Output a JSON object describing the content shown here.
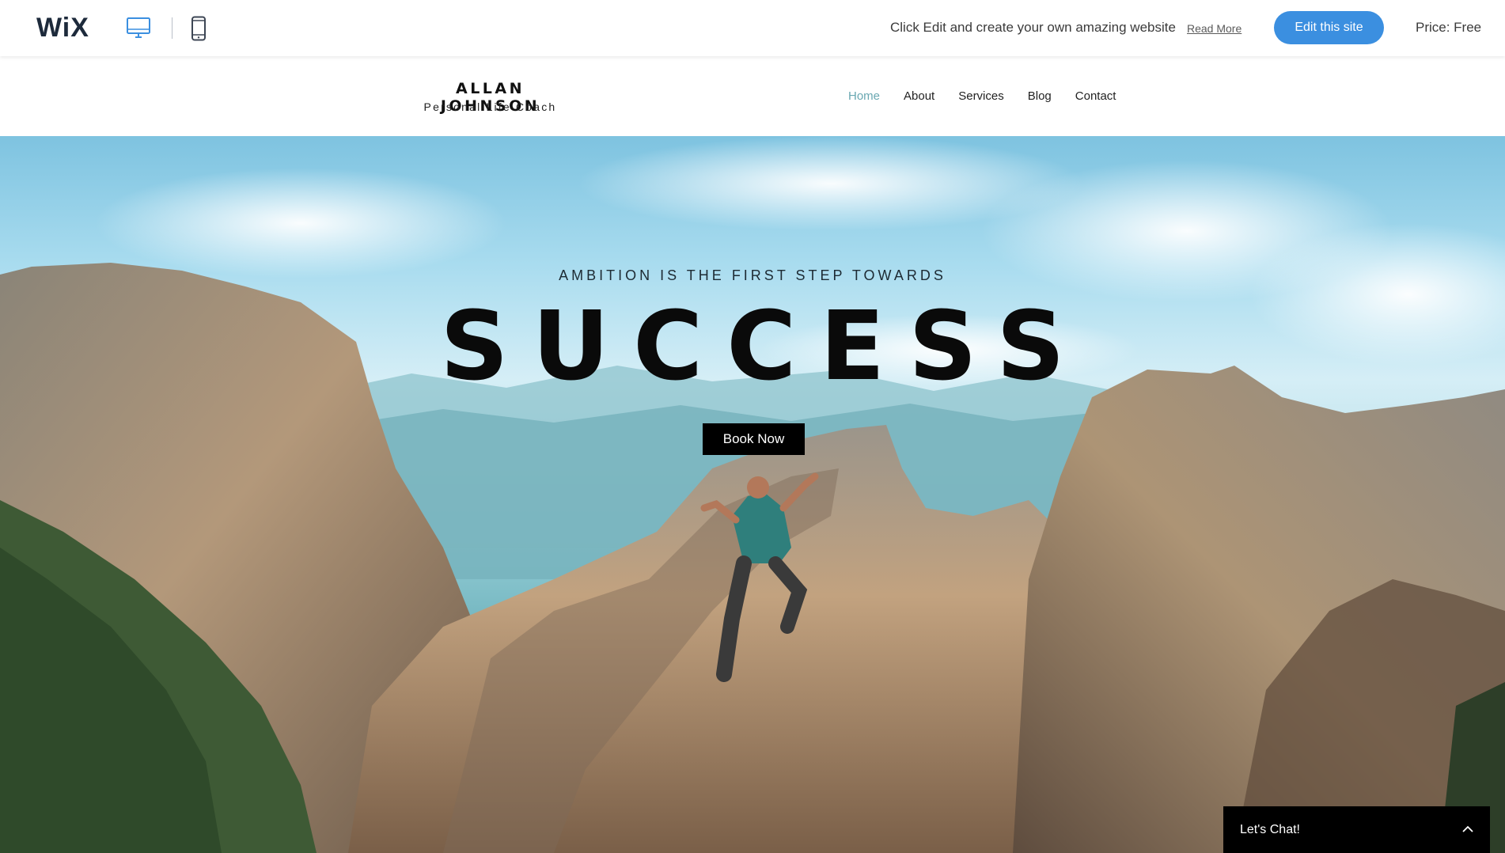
{
  "wix_bar": {
    "logo": "WiX",
    "desktop_icon": "desktop-monitor-icon",
    "mobile_icon": "mobile-phone-icon",
    "promo_text": "Click Edit and create your own amazing website",
    "read_more": "Read More",
    "edit_button": "Edit this site",
    "price": "Price: Free",
    "accent_color": "#3b8fe0"
  },
  "site": {
    "brand_name": "ALLAN JOHNSON",
    "brand_tagline": "Personal Life Coach",
    "nav": [
      {
        "label": "Home",
        "active": true
      },
      {
        "label": "About",
        "active": false
      },
      {
        "label": "Services",
        "active": false
      },
      {
        "label": "Blog",
        "active": false
      },
      {
        "label": "Contact",
        "active": false
      }
    ],
    "active_nav_color": "#6aa8b2"
  },
  "hero": {
    "tagline": "AMBITION IS THE FIRST STEP TOWARDS",
    "headline": "SUCCESS",
    "cta": "Book Now"
  },
  "chat": {
    "label": "Let's Chat!",
    "icon": "chevron-up-icon"
  }
}
